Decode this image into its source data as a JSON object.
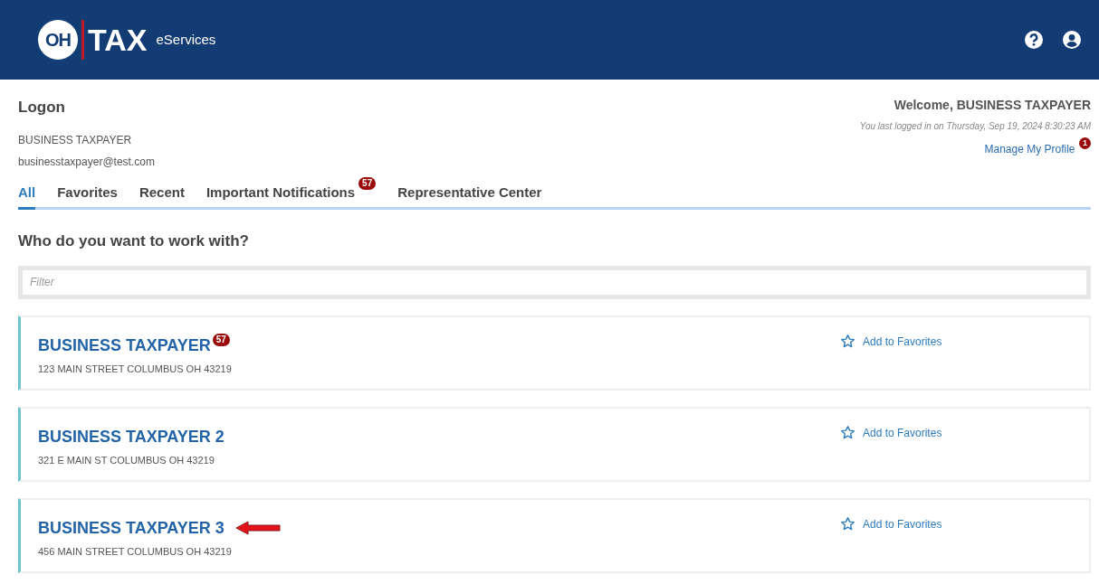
{
  "header": {
    "logo": {
      "circle_text": "OH",
      "main_text": "TAX",
      "sub_text": "eServices"
    }
  },
  "user": {
    "title": "Logon",
    "name": "BUSINESS TAXPAYER",
    "email": "businesstaxpayer@test.com"
  },
  "welcome": {
    "greeting": "Welcome, BUSINESS TAXPAYER",
    "last_login": "You last logged in on Thursday, Sep 19, 2024 8:30:23 AM",
    "profile_link": "Manage My Profile",
    "profile_badge": "1"
  },
  "tabs": [
    {
      "label": "All",
      "selected": true
    },
    {
      "label": "Favorites",
      "selected": false
    },
    {
      "label": "Recent",
      "selected": false
    },
    {
      "label": "Important Notifications",
      "selected": false,
      "badge": "57"
    },
    {
      "label": "Representative Center",
      "selected": false
    }
  ],
  "heading": "Who do you want to work with?",
  "filter": {
    "placeholder": "Filter"
  },
  "accounts": [
    {
      "name": "BUSINESS TAXPAYER",
      "badge": "57",
      "address": "123 MAIN STREET COLUMBUS OH 43219",
      "favorite_label": "Add to Favorites",
      "favorite": false,
      "pointed": false
    },
    {
      "name": "BUSINESS TAXPAYER 2",
      "address": "321 E MAIN ST COLUMBUS OH 43219",
      "favorite_label": "Add to Favorites",
      "favorite": false,
      "pointed": false
    },
    {
      "name": "BUSINESS TAXPAYER 3",
      "address": "456 MAIN STREET COLUMBUS OH 43219",
      "favorite_label": "Add to Favorites",
      "favorite": false,
      "pointed": true
    }
  ]
}
